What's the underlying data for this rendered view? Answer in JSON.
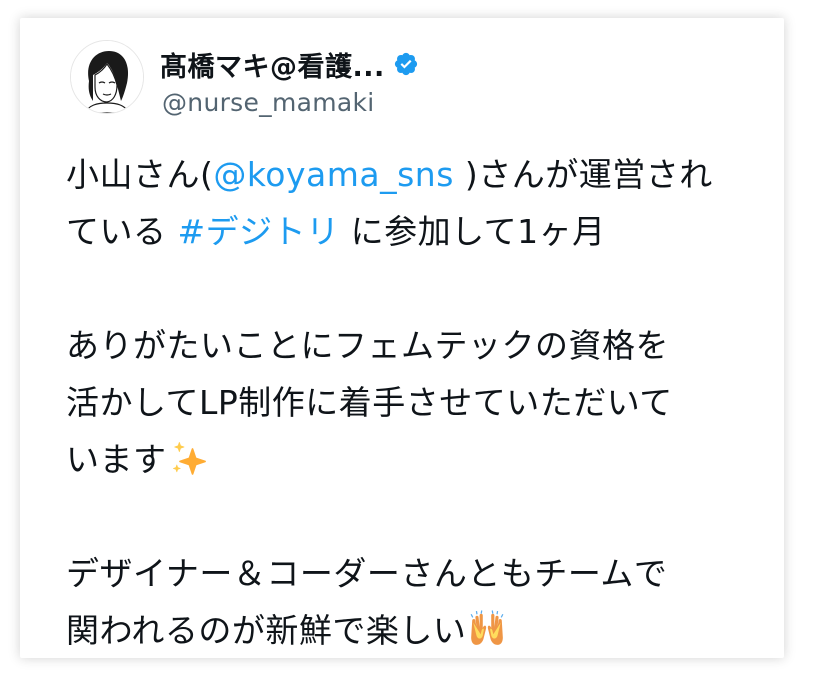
{
  "tweet": {
    "author": {
      "display_name": "髙橋マキ@看護...",
      "handle": "@nurse_mamaki",
      "avatar_icon": "avatar-illustration-icon",
      "verified_icon": "verified-badge-icon"
    },
    "body": {
      "p1_text1": "小山さん(",
      "p1_mention": "@koyama_sns",
      "p1_text2": " )さんが運営され",
      "p1_text3": "ている ",
      "p1_hashtag": "#デジトリ",
      "p1_text4": " に参加して1ヶ月",
      "p2_line1": "ありがたいことにフェムテックの資格を",
      "p2_line2": "活かしてLP制作に着手させていただいて",
      "p2_line3": "います",
      "p3_line1": "デザイナー＆コーダーさんともチームで",
      "p3_line2": "関われるのが新鮮で楽しい"
    },
    "emoji": {
      "sparkles": "sparkles-icon",
      "raising_hands": "raising-hands-icon"
    },
    "colors": {
      "link": "#1d9bf0",
      "text": "#0f1419",
      "secondary": "#536471",
      "verified": "#1d9bf0"
    }
  }
}
